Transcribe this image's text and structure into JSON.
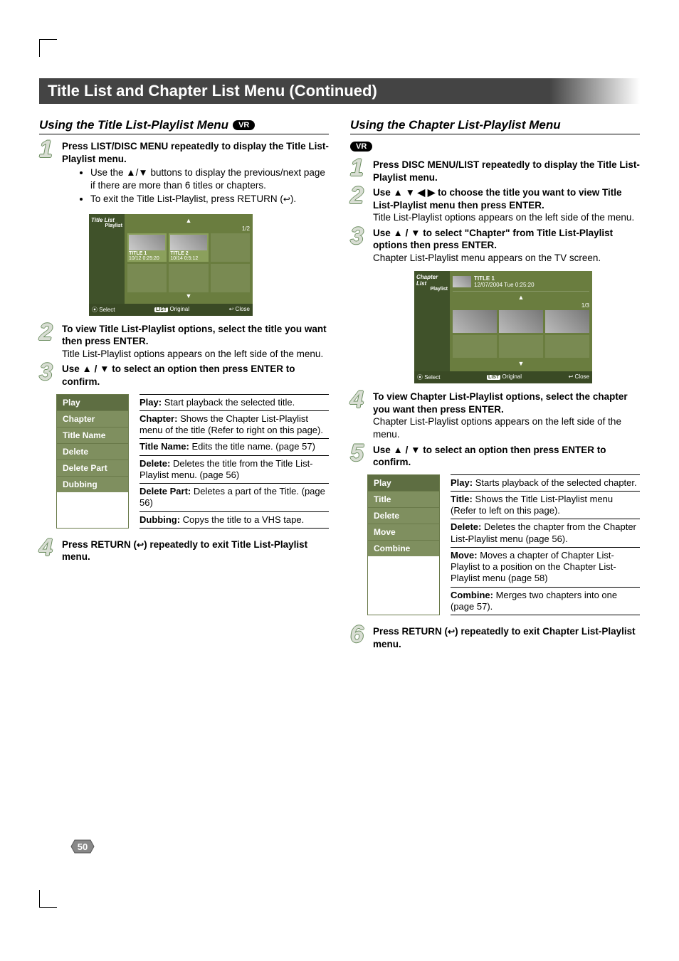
{
  "titleBar": "Title List and Chapter List Menu (Continued)",
  "vrLabel": "VR",
  "left": {
    "heading": "Using the Title List-Playlist Menu",
    "step1": "Press LIST/DISC MENU repeatedly to display the Title List-Playlist menu.",
    "step1_bullet1": "Use the ▲/▼ buttons to display the previous/next page if there are more than 6 titles or chapters.",
    "step1_bullet2": "To exit the Title List-Playlist, press RETURN (",
    "step1_bullet2_tail": ").",
    "step2": "To view Title List-Playlist options, select the title you want then press ENTER.",
    "step2_sub": "Title List-Playlist options appears on the left side of the menu.",
    "step3": "Use ▲ / ▼ to select an option then press ENTER to confirm.",
    "step4": "Press RETURN (",
    "step4_tail": ") repeatedly to exit Title List-Playlist menu.",
    "options": [
      "Play",
      "Chapter",
      "Title Name",
      "Delete",
      "Delete Part",
      "Dubbing"
    ],
    "desc": [
      {
        "t": "Play:",
        "d": "Start playback the selected title."
      },
      {
        "t": "Chapter:",
        "d": "Shows the Chapter List-Playlist menu of the title (Refer to right on this page)."
      },
      {
        "t": "Title Name:",
        "d": "Edits the title name. (page 57)"
      },
      {
        "t": "Delete:",
        "d": "Deletes the title from the Title List-Playlist  menu. (page 56)"
      },
      {
        "t": "Delete Part:",
        "d": "Deletes a part of the Title. (page 56)"
      },
      {
        "t": "Dubbing:",
        "d": "Copys the title to a VHS tape."
      }
    ],
    "osd": {
      "side": "Title List",
      "sideSub": "Playlist",
      "page": "1/2",
      "title1": "TITLE 1",
      "t1sub": "10/12    0:25:20",
      "title2": "TITLE 2",
      "t2sub": "10/14    0:5:12",
      "footSelect": "Select",
      "footOriginal": "Original",
      "footClose": "Close",
      "listBadge": "LIST"
    }
  },
  "right": {
    "heading": "Using the Chapter List-Playlist Menu",
    "step1": "Press DISC MENU/LIST repeatedly to display the Title List-Playlist menu.",
    "step2": "Use ▲ ▼ ◀ ▶ to choose the title you want to view Title List-Playlist menu then press ENTER.",
    "step2_sub": "Title List-Playlist options appears on the left side of the menu.",
    "step3": "Use ▲ / ▼ to select \"Chapter\" from Title List-Playlist options then press ENTER.",
    "step3_sub": "Chapter List-Playlist menu appears on the TV screen.",
    "step4": "To view Chapter List-Playlist options, select the chapter you want then press ENTER.",
    "step4_sub": "Chapter List-Playlist options appears on the left side of the menu.",
    "step5": "Use ▲ / ▼ to select an option then press ENTER to confirm.",
    "step6": "Press RETURN (",
    "step6_tail": ") repeatedly to exit Chapter List-Playlist menu.",
    "options": [
      "Play",
      "Title",
      "Delete",
      "Move",
      "Combine"
    ],
    "desc": [
      {
        "t": "Play:",
        "d": "Starts playback of the selected chapter."
      },
      {
        "t": "Title:",
        "d": "Shows the Title List-Playlist menu (Refer to left on this page)."
      },
      {
        "t": "Delete:",
        "d": "Deletes the chapter from the Chapter List-Playlist menu (page 56)."
      },
      {
        "t": "Move:",
        "d": "Moves a chapter of Chapter List-Playlist to a position on the Chapter List-Playlist menu (page 58)"
      },
      {
        "t": "Combine:",
        "d": "Merges two chapters into one (page 57)."
      }
    ],
    "osd": {
      "side": "Chapter List",
      "sideSub": "Playlist",
      "header": "TITLE 1",
      "headerSub": "12/07/2004  Tue 0:25:20",
      "page": "1/3",
      "footSelect": "Select",
      "footOriginal": "Original",
      "footClose": "Close",
      "listBadge": "LIST"
    }
  },
  "pageNumber": "50"
}
